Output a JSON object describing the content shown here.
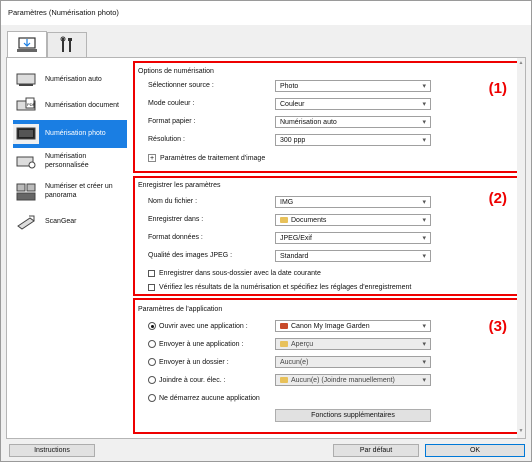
{
  "window": {
    "title": "Paramètres (Numérisation photo)"
  },
  "tabs": [
    {
      "icon": "scan-computer-icon"
    },
    {
      "icon": "tools-icon"
    }
  ],
  "sidebar": {
    "items": [
      {
        "label": "Numérisation auto",
        "icon": "auto-scan-icon"
      },
      {
        "label": "Numérisation document",
        "icon": "document-scan-icon"
      },
      {
        "label": "Numérisation photo",
        "icon": "photo-scan-icon",
        "selected": true
      },
      {
        "label": "Numérisation personnalisée",
        "icon": "custom-scan-icon"
      },
      {
        "label": "Numériser et créer un panorama",
        "icon": "panorama-icon"
      },
      {
        "label": "ScanGear",
        "icon": "scangear-icon"
      }
    ]
  },
  "scan_options": {
    "title": "Options de numérisation",
    "number": "(1)",
    "source_label": "Sélectionner source :",
    "source_value": "Photo",
    "color_label": "Mode couleur :",
    "color_value": "Couleur",
    "paper_label": "Format papier :",
    "paper_value": "Numérisation auto",
    "resolution_label": "Résolution :",
    "resolution_value": "300 ppp",
    "image_processing_label": "Paramètres de traitement d'image"
  },
  "save_settings": {
    "title": "Enregistrer les paramètres",
    "number": "(2)",
    "filename_label": "Nom du fichier :",
    "filename_value": "IMG",
    "save_in_label": "Enregistrer dans :",
    "save_in_value": "Documents",
    "format_label": "Format données :",
    "format_value": "JPEG/Exif",
    "quality_label": "Qualité des images JPEG :",
    "quality_value": "Standard",
    "subfolder_label": "Enregistrer dans sous-dossier avec la date courante",
    "check_results_label": "Vérifiez les résultats de la numérisation et spécifiez les réglages d'enregistrement"
  },
  "app_settings": {
    "title": "Paramètres de l'application",
    "number": "(3)",
    "open_app_label": "Ouvrir avec une application :",
    "open_app_value": "Canon My Image Garden",
    "send_app_label": "Envoyer à une application :",
    "send_app_value": "Aperçu",
    "send_folder_label": "Envoyer à un dossier :",
    "send_folder_value": "Aucun(e)",
    "attach_email_label": "Joindre à cour. élec. :",
    "attach_email_value": "Aucun(e) (Joindre manuellement)",
    "no_app_label": "Ne démarrez aucune application",
    "more_functions_label": "Fonctions supplémentaires"
  },
  "footer": {
    "instructions_label": "Instructions",
    "defaults_label": "Par défaut",
    "ok_label": "OK"
  },
  "colors": {
    "highlight": "#e00000",
    "selection": "#1a7ee3"
  }
}
